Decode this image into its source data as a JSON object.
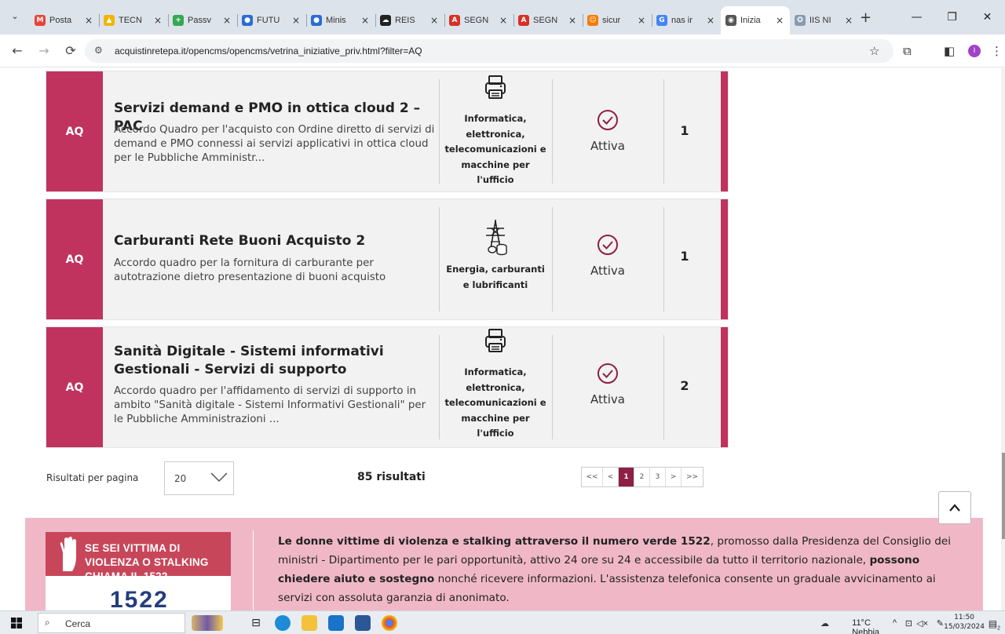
{
  "browser": {
    "tabs": [
      {
        "title": "Posta",
        "fav_color": "#ea4335",
        "fav_char": "M"
      },
      {
        "title": "TECN",
        "fav_color": "#f4b400",
        "fav_char": "▲"
      },
      {
        "title": "Passv",
        "fav_color": "#34a853",
        "fav_char": "+"
      },
      {
        "title": "FUTU",
        "fav_color": "#2b6cd4",
        "fav_char": "●"
      },
      {
        "title": "Minis",
        "fav_color": "#2b6cd4",
        "fav_char": "●"
      },
      {
        "title": "REIS",
        "fav_color": "#222222",
        "fav_char": "☁"
      },
      {
        "title": "SEGN",
        "fav_color": "#d93025",
        "fav_char": "A"
      },
      {
        "title": "SEGN",
        "fav_color": "#d93025",
        "fav_char": "A"
      },
      {
        "title": "sicur",
        "fav_color": "#f57c00",
        "fav_char": "☺"
      },
      {
        "title": "nas ir",
        "fav_color": "#4285f4",
        "fav_char": "G"
      },
      {
        "title": "Inizia",
        "fav_color": "#555555",
        "fav_char": "◉",
        "active": true
      },
      {
        "title": "IIS NI",
        "fav_color": "#8a9bb0",
        "fav_char": "✪"
      }
    ],
    "url": "acquistinretepa.it/opencms/opencms/vetrina_iniziative_priv.html?filter=AQ",
    "profile_initial": "I"
  },
  "initiatives": [
    {
      "badge": "AQ",
      "title": "Servizi demand e PMO in ottica cloud 2 – PAC",
      "description": "Accordo Quadro per l'acquisto con Ordine diretto di servizi di demand e PMO connessi ai servizi applicativi in ottica cloud per le Pubbliche Amministr...",
      "category_icon": "printer-icon",
      "category_lines": [
        "Informatica,",
        "elettronica,",
        "telecomunicazioni e",
        "macchine per",
        "l'ufficio"
      ],
      "status": "Attiva",
      "count": "1"
    },
    {
      "badge": "AQ",
      "title": "Carburanti Rete Buoni Acquisto 2",
      "description": "Accordo quadro per la fornitura di carburante per autotrazione dietro presentazione di buoni acquisto",
      "category_icon": "power-tower-icon",
      "category_lines": [
        "Energia, carburanti",
        "e lubrificanti"
      ],
      "status": "Attiva",
      "count": "1"
    },
    {
      "badge": "AQ",
      "title": "Sanità Digitale - Sistemi informativi Gestionali - Servizi di supporto",
      "description": "Accordo quadro per l'affidamento di servizi di supporto in ambito \"Sanità digitale - Sistemi Informativi Gestionali\" per le Pubbliche Amministrazioni ...",
      "category_icon": "printer-icon",
      "category_lines": [
        "Informatica,",
        "elettronica,",
        "telecomunicazioni e",
        "macchine per",
        "l'ufficio"
      ],
      "status": "Attiva",
      "count": "2"
    }
  ],
  "results": {
    "per_page_label": "Risultati per pagina",
    "per_page_value": "20",
    "total_label": "85 risultati",
    "pages": [
      "<<",
      "<",
      "1",
      "2",
      "3",
      ">",
      ">>"
    ],
    "current_page": "1"
  },
  "banner": {
    "image_text": "SE SEI VITTIMA DI VIOLENZA O STALKING CHIAMA IL 1522",
    "image_number": "1522",
    "text_bold_1": "Le donne vittime di violenza e stalking attraverso il numero verde 1522",
    "text_1": ", promosso dalla Presidenza del Consiglio dei ministri - Dipartimento per le pari opportunità, attivo 24 ore su 24 e accessibile da tutto il territorio nazionale, ",
    "text_bold_2": "possono chiedere aiuto e sostegno",
    "text_2": " nonché ricevere informazioni. L'assistenza telefonica consente un graduale avvicinamento ai servizi con assoluta garanzia di anonimato."
  },
  "taskbar": {
    "search_placeholder": "Cerca",
    "weather": "11°C  Nebbia",
    "time": "11:50",
    "date": "15/03/2024",
    "notification_count": "2"
  },
  "colors": {
    "accent": "#c0335f",
    "pager_active": "#8e1f47",
    "banner_bg": "#f0b8c6"
  }
}
